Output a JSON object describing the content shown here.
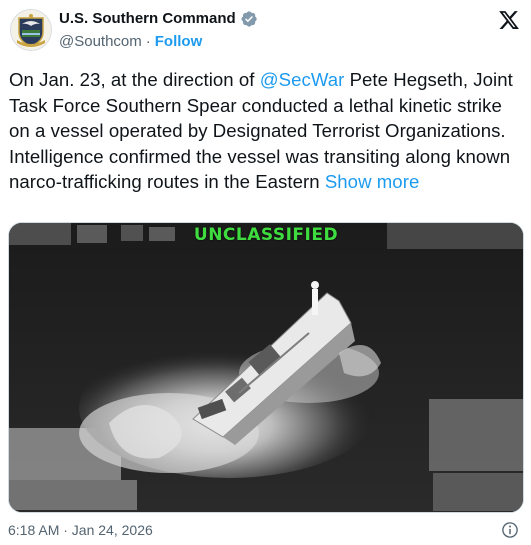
{
  "header": {
    "display_name": "U.S. Southern Command",
    "handle": "@Southcom",
    "separator": "·",
    "follow_label": "Follow"
  },
  "tweet": {
    "text_part1": "On Jan. 23, at the direction of ",
    "mention": "@SecWar",
    "text_part2": " Pete Hegseth, Joint Task Force Southern Spear conducted a lethal kinetic strike on a vessel operated by Designated Terrorist Organizations. Intelligence confirmed the vessel was transiting along known narco-trafficking routes in the Eastern ",
    "show_more": "Show more"
  },
  "media": {
    "overlay_label": "UNCLASSIFIED"
  },
  "footer": {
    "timestamp": "6:18 AM · Jan 24, 2026"
  },
  "colors": {
    "link": "#1d9bf0",
    "text": "#0f1419",
    "secondary": "#536471",
    "overlay_green": "#3fdc3f"
  },
  "icons": {
    "verified": "verified-badge-icon",
    "brand": "x-logo-icon",
    "info": "info-icon",
    "avatar": "southcom-seal-icon"
  }
}
